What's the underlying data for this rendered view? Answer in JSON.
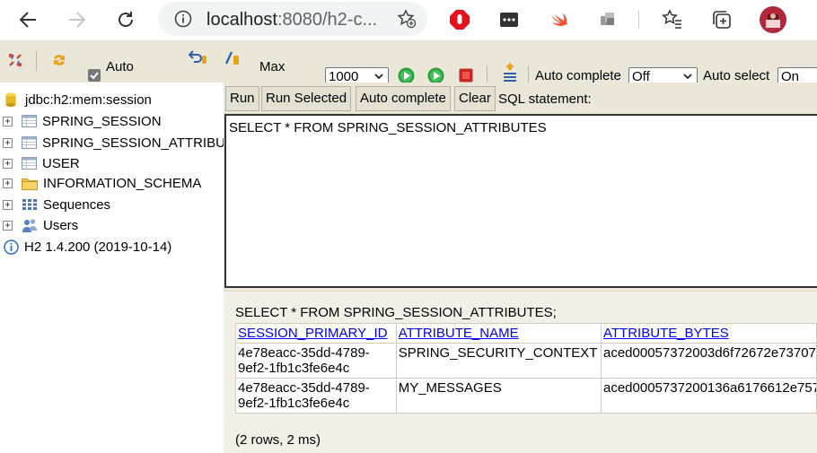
{
  "browser": {
    "address_host": "localhost",
    "address_rest": ":8080/h2-c..."
  },
  "toolbar": {
    "auto_commit_label": "Auto",
    "max_label": "Max",
    "max_rows_value": "1000",
    "auto_complete_label": "Auto complete",
    "auto_complete_value": "Off",
    "auto_select_label": "Auto select",
    "auto_select_value": "On"
  },
  "tree": {
    "connection": "jdbc:h2:mem:session",
    "items": [
      {
        "label": "SPRING_SESSION",
        "icon": "table-icon"
      },
      {
        "label": "SPRING_SESSION_ATTRIBUTES",
        "icon": "table-icon"
      },
      {
        "label": "USER",
        "icon": "table-icon"
      },
      {
        "label": "INFORMATION_SCHEMA",
        "icon": "folder-icon"
      },
      {
        "label": "Sequences",
        "icon": "sequences-icon"
      },
      {
        "label": "Users",
        "icon": "users-icon"
      }
    ],
    "version": "H2 1.4.200 (2019-10-14)"
  },
  "buttons": {
    "run": "Run",
    "run_selected": "Run Selected",
    "auto_complete": "Auto complete",
    "clear": "Clear"
  },
  "sql": {
    "label": "SQL statement:",
    "text": "SELECT * FROM SPRING_SESSION_ATTRIBUTES"
  },
  "result": {
    "statement": "SELECT * FROM SPRING_SESSION_ATTRIBUTES;",
    "columns": [
      "SESSION_PRIMARY_ID",
      "ATTRIBUTE_NAME",
      "ATTRIBUTE_BYTES"
    ],
    "rows": [
      {
        "id_line1": "4e78eacc-35dd-4789-",
        "id_line2": "9ef2-1fb1c3fe6e4c",
        "name": "SPRING_SECURITY_CONTEXT",
        "bytes": "aced00057372003d6f72672e73707"
      },
      {
        "id_line1": "4e78eacc-35dd-4789-",
        "id_line2": "9ef2-1fb1c3fe6e4c",
        "name": "MY_MESSAGES",
        "bytes": "aced0005737200136a6176612e757"
      }
    ],
    "footer": "(2 rows, 2 ms)"
  },
  "colors": {
    "toolbar_bg": "#eae7d8",
    "result_bg": "#f2f0e6",
    "link": "#0000ee"
  }
}
